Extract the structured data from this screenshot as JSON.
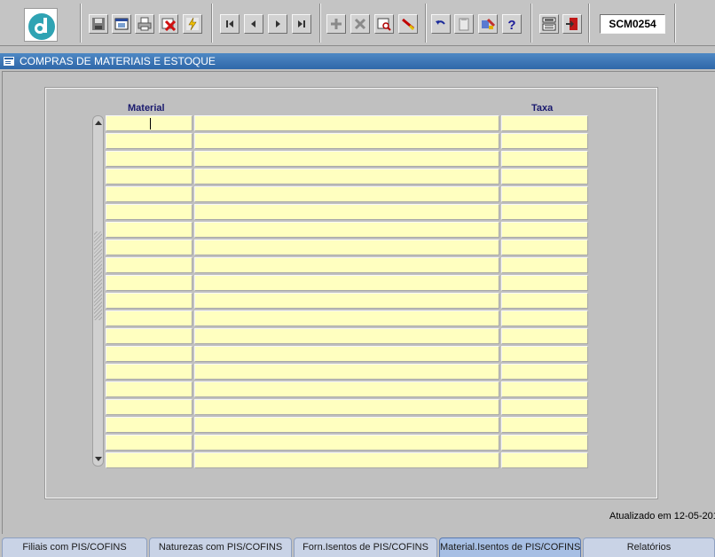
{
  "toolbar": {
    "logo_icon": "dynamic-d-logo-icon",
    "buttons": [
      {
        "name": "save-button",
        "icon": "floppy-disk-icon"
      },
      {
        "name": "window-button",
        "icon": "window-icon"
      },
      {
        "name": "print-button",
        "icon": "printer-icon"
      },
      {
        "name": "cancel-button",
        "icon": "red-x-icon"
      },
      {
        "name": "execute-button",
        "icon": "lightning-icon"
      },
      {
        "name": "first-record-button",
        "icon": "first-record-icon"
      },
      {
        "name": "previous-record-button",
        "icon": "previous-record-icon"
      },
      {
        "name": "next-record-button",
        "icon": "next-record-icon"
      },
      {
        "name": "last-record-button",
        "icon": "last-record-icon"
      },
      {
        "name": "insert-record-button",
        "icon": "plus-icon"
      },
      {
        "name": "delete-record-button",
        "icon": "x-icon"
      },
      {
        "name": "query-button",
        "icon": "query-icon"
      },
      {
        "name": "clear-button",
        "icon": "eraser-icon"
      },
      {
        "name": "undo-button",
        "icon": "undo-icon"
      },
      {
        "name": "clipboard-button",
        "icon": "clipboard-icon"
      },
      {
        "name": "tools-button",
        "icon": "tools-icon"
      },
      {
        "name": "help-button",
        "icon": "question-icon"
      },
      {
        "name": "menu-button",
        "icon": "menu-icon"
      },
      {
        "name": "exit-button",
        "icon": "exit-door-icon"
      }
    ],
    "form_code": "SCM0254"
  },
  "titlebar": {
    "title": "COMPRAS DE MATERIAIS E ESTOQUE",
    "icon": "form-icon"
  },
  "grid": {
    "headers": {
      "material": "Material",
      "description": "",
      "taxa": "Taxa"
    },
    "row_count": 20
  },
  "footer": {
    "updated_text": "Atualizado em 12-05-201"
  },
  "tabs": [
    {
      "label": "Filiais com PIS/COFINS",
      "active": false
    },
    {
      "label": "Naturezas com PIS/COFINS",
      "active": false
    },
    {
      "label": "Forn.Isentos de PIS/COFINS",
      "active": false
    },
    {
      "label": "Material.Isentos de PIS/COFINS",
      "active": true
    },
    {
      "label": "Relatórios",
      "active": false
    }
  ],
  "colors": {
    "title_bar": "#2f67a9",
    "cell_background": "#ffffc0",
    "active_tab": "#a7bfe4"
  }
}
